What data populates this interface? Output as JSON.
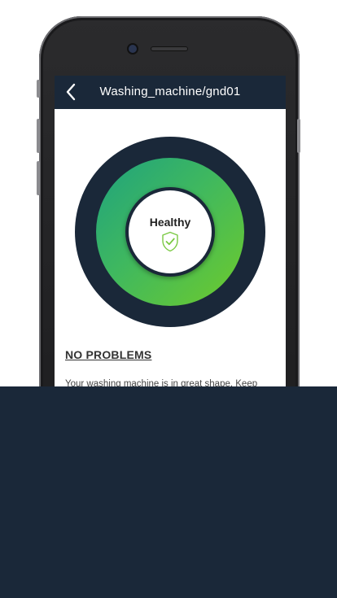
{
  "header": {
    "title": "Washing_machine/gnd01",
    "back_icon": "chevron-left-icon"
  },
  "status": {
    "label": "Healthy",
    "icon": "shield-check-icon"
  },
  "problems": {
    "heading": "NO PROBLEMS",
    "message": "Your washing machine is in great shape.  Keep"
  },
  "colors": {
    "navbar": "#1a2839",
    "gauge_ring_dark": "#1a2839",
    "gauge_green_start": "#1fa27e",
    "gauge_green_end": "#6fcb2b",
    "shield_green": "#7ac943",
    "bottom_panel": "#1a2839"
  }
}
